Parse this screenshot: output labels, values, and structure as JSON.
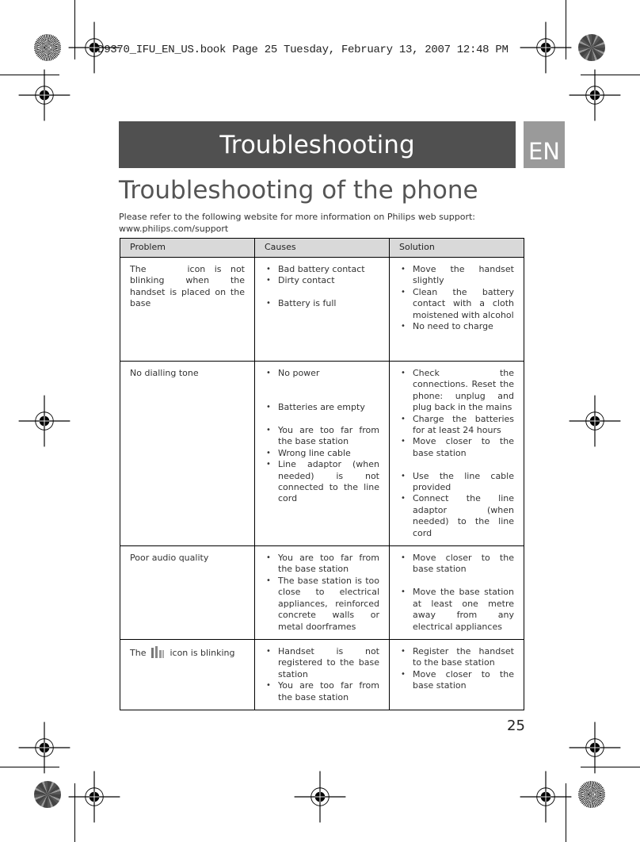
{
  "print_header": "ID9370_IFU_EN_US.book  Page 25  Tuesday, February 13, 2007  12:48 PM",
  "banner": {
    "title": "Troubleshooting",
    "language": "EN"
  },
  "page_title": "Troubleshooting of the phone",
  "intro": {
    "line1": "Please refer to the following website for more information on Philips web support:",
    "line2": "www.philips.com/support"
  },
  "table": {
    "headers": [
      "Problem",
      "Causes",
      "Solution"
    ],
    "rows": [
      {
        "problem_prefix": "The",
        "problem_icon": "battery-icon",
        "problem_suffix": "icon is not blinking when the handset is placed on the base",
        "causes": [
          "Bad battery contact",
          "Dirty contact",
          "Battery is full"
        ],
        "solutions": [
          "Move the handset slightly",
          "Clean the battery contact with a cloth moistened with alcohol",
          "No need to charge"
        ]
      },
      {
        "problem": "No dialling tone",
        "causes": [
          "No power",
          "Batteries are empty",
          "You are too far from the base station",
          "Wrong line cable",
          "Line adaptor (when needed) is not connected to the line cord"
        ],
        "solutions": [
          "Check the connections. Reset the phone: unplug and plug back in the mains",
          "Charge the batteries for at least 24 hours",
          "Move closer to the base station",
          "Use the line cable provided",
          "Connect the line adaptor (when needed) to the line cord"
        ]
      },
      {
        "problem": "Poor audio quality",
        "causes": [
          "You are too far from the base station",
          "The base station is too close to electrical appliances, reinforced concrete walls or metal doorframes"
        ],
        "solutions": [
          "Move closer to the base station",
          "Move the base station at least one metre away from any electrical appliances"
        ]
      },
      {
        "problem_prefix": "The",
        "problem_icon": "signal-strength-icon",
        "problem_suffix": "icon is blinking",
        "causes": [
          "Handset is not registered to the base station",
          "You are too far from the base station"
        ],
        "solutions": [
          "Register the handset to the base station",
          "Move closer to the base station"
        ]
      }
    ]
  },
  "page_number": "25"
}
